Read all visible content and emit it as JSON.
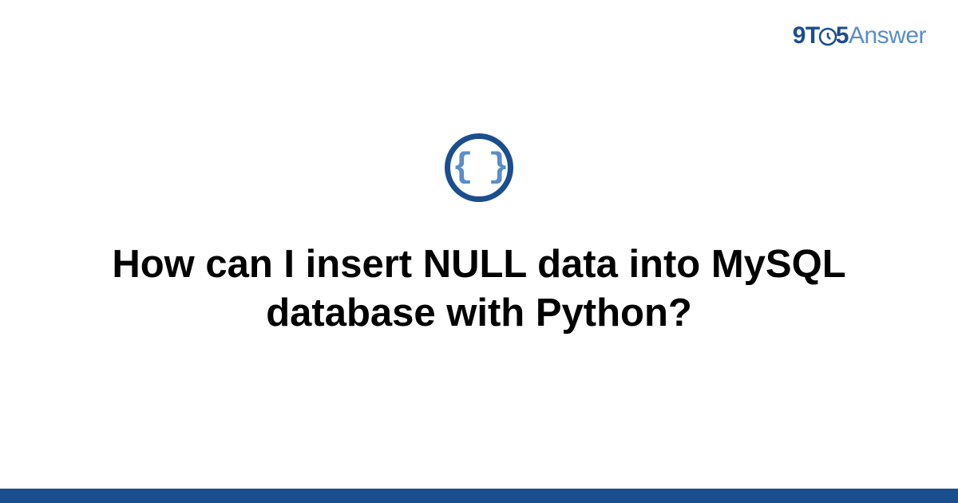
{
  "header": {
    "logo_prefix": "9T",
    "logo_digit": "5",
    "logo_suffix": "Answer"
  },
  "main": {
    "icon": "code-braces-icon",
    "braces_glyph": "{ }",
    "title": "How can I insert NULL data into MySQL database with Python?"
  },
  "colors": {
    "brand_dark": "#1a4e8f",
    "brand_light": "#5a8dc9"
  }
}
